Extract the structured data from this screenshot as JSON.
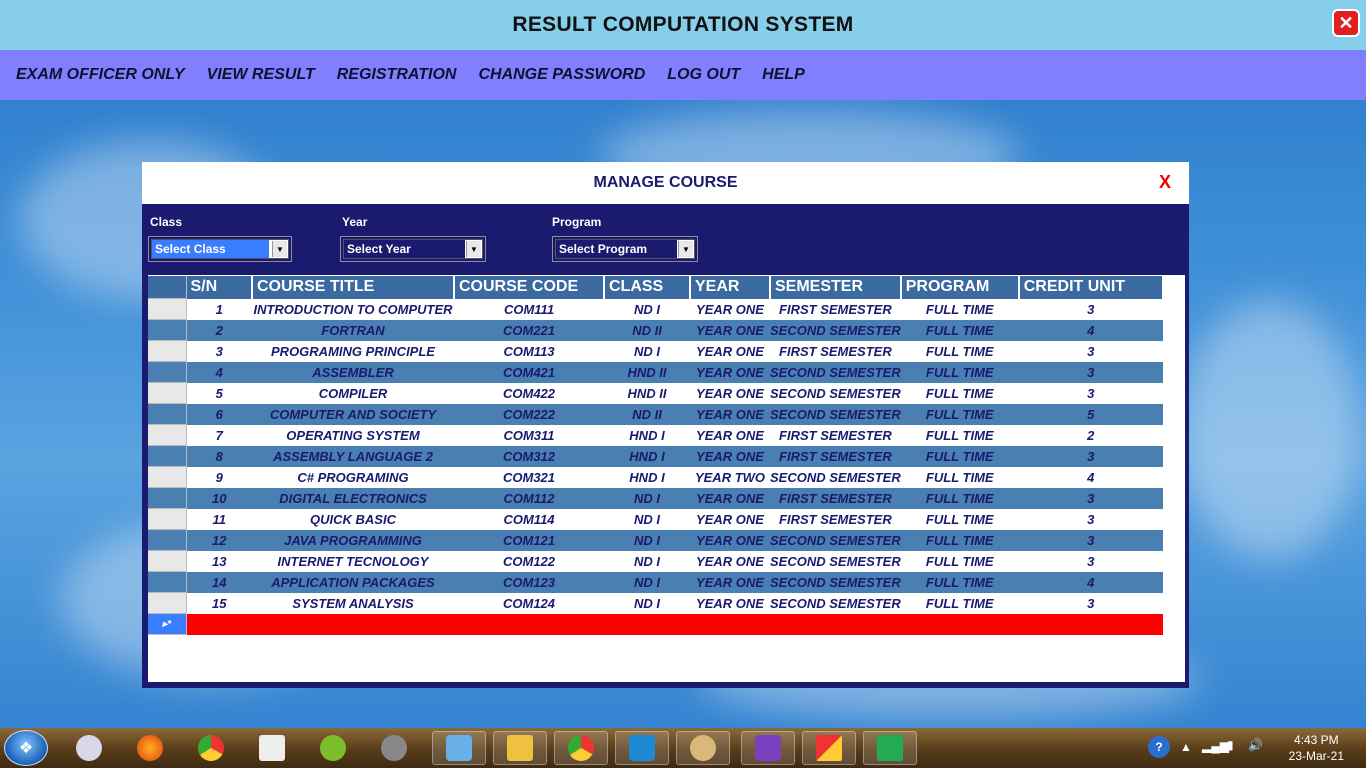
{
  "window": {
    "title": "RESULT COMPUTATION SYSTEM",
    "close_label": "✕"
  },
  "menu": [
    "EXAM OFFICER ONLY",
    "VIEW RESULT",
    "REGISTRATION",
    "CHANGE PASSWORD",
    "LOG OUT",
    "HELP"
  ],
  "dialog": {
    "title": "MANAGE COURSE",
    "close_label": "X",
    "filters": {
      "class": {
        "label": "Class",
        "value": "Select Class"
      },
      "year": {
        "label": "Year",
        "value": "Select Year"
      },
      "program": {
        "label": "Program",
        "value": "Select Program"
      }
    },
    "grid": {
      "columns": [
        "S/N",
        "COURSE TITLE",
        "COURSE CODE",
        "CLASS",
        "YEAR",
        "SEMESTER",
        "PROGRAM",
        "CREDIT UNIT"
      ],
      "rows": [
        [
          "1",
          "INTRODUCTION TO COMPUTER",
          "COM111",
          "ND I",
          "YEAR ONE",
          "FIRST SEMESTER",
          "FULL TIME",
          "3"
        ],
        [
          "2",
          "FORTRAN",
          "COM221",
          "ND II",
          "YEAR ONE",
          "SECOND SEMESTER",
          "FULL TIME",
          "4"
        ],
        [
          "3",
          "PROGRAMING PRINCIPLE",
          "COM113",
          "ND I",
          "YEAR ONE",
          "FIRST SEMESTER",
          "FULL TIME",
          "3"
        ],
        [
          "4",
          "ASSEMBLER",
          "COM421",
          "HND II",
          "YEAR ONE",
          "SECOND SEMESTER",
          "FULL TIME",
          "3"
        ],
        [
          "5",
          "COMPILER",
          "COM422",
          "HND II",
          "YEAR ONE",
          "SECOND SEMESTER",
          "FULL TIME",
          "3"
        ],
        [
          "6",
          "COMPUTER AND SOCIETY",
          "COM222",
          "ND II",
          "YEAR ONE",
          "SECOND SEMESTER",
          "FULL TIME",
          "5"
        ],
        [
          "7",
          "OPERATING SYSTEM",
          "COM311",
          "HND I",
          "YEAR ONE",
          "FIRST SEMESTER",
          "FULL TIME",
          "2"
        ],
        [
          "8",
          "ASSEMBLY LANGUAGE 2",
          "COM312",
          "HND I",
          "YEAR ONE",
          "FIRST SEMESTER",
          "FULL TIME",
          "3"
        ],
        [
          "9",
          "C# PROGRAMING",
          "COM321",
          "HND I",
          "YEAR TWO",
          "SECOND SEMESTER",
          "FULL TIME",
          "4"
        ],
        [
          "10",
          "DIGITAL ELECTRONICS",
          "COM112",
          "ND I",
          "YEAR ONE",
          "FIRST SEMESTER",
          "FULL TIME",
          "3"
        ],
        [
          "11",
          "QUICK BASIC",
          "COM114",
          "ND I",
          "YEAR ONE",
          "FIRST SEMESTER",
          "FULL TIME",
          "3"
        ],
        [
          "12",
          "JAVA PROGRAMMING",
          "COM121",
          "ND I",
          "YEAR ONE",
          "SECOND SEMESTER",
          "FULL TIME",
          "3"
        ],
        [
          "13",
          "INTERNET TECNOLOGY",
          "COM122",
          "ND I",
          "YEAR ONE",
          "SECOND SEMESTER",
          "FULL TIME",
          "3"
        ],
        [
          "14",
          "APPLICATION PACKAGES",
          "COM123",
          "ND I",
          "YEAR ONE",
          "SECOND SEMESTER",
          "FULL TIME",
          "4"
        ],
        [
          "15",
          "SYSTEM ANALYSIS",
          "COM124",
          "ND I",
          "YEAR ONE",
          "SECOND SEMESTER",
          "FULL TIME",
          "3"
        ]
      ],
      "new_row_marker": "▸*"
    }
  },
  "taskbar": {
    "apps": [
      "paint-icon",
      "firefox-icon",
      "chrome-icon",
      "setup-icon",
      "chameleon-icon",
      "rocket-icon",
      "virtualbox-icon",
      "file-explorer-icon",
      "chrome-icon",
      "vscode-icon",
      "paint-palette-icon",
      "visual-studio-icon",
      "office-icon",
      "task-manager-icon"
    ],
    "clock_time": "4:43 PM",
    "clock_date": "23-Mar-21",
    "help_icon": "?"
  },
  "colors": {
    "titlebar": "#87ceeb",
    "menubar": "#8080ff",
    "dialog": "#1a1a6e",
    "alt_row": "#4a7fb2",
    "new_row": "#ff0000"
  }
}
